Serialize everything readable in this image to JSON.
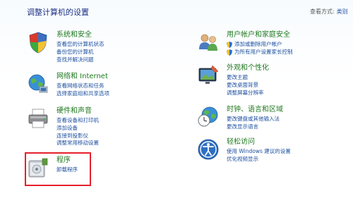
{
  "header": {
    "title": "调整计算机的设置"
  },
  "view_by": {
    "label": "查看方式:",
    "value": "类别"
  },
  "categories_left": [
    {
      "title": "系统和安全",
      "links": [
        "查看您的计算机状态",
        "备份您的计算机",
        "查找并解决问题"
      ],
      "icon": "shield-flag-icon"
    },
    {
      "title": "网络和 Internet",
      "links": [
        "查看网络状态和任务",
        "选择家庭组和共享选项"
      ],
      "icon": "network-globe-icon"
    },
    {
      "title": "硬件和声音",
      "links": [
        "查看设备和打印机",
        "添加设备",
        "连接到投影仪",
        "调整常用移动设置"
      ],
      "icon": "printer-icon"
    },
    {
      "title": "程序",
      "links": [
        "卸载程序"
      ],
      "icon": "programs-icon"
    }
  ],
  "categories_right": [
    {
      "title": "用户帐户和家庭安全",
      "links": [
        "添加或删除用户帐户",
        "为所有用户设置家长控制"
      ],
      "icon": "users-icon"
    },
    {
      "title": "外观和个性化",
      "links": [
        "更改主题",
        "更改桌面背景",
        "调整屏幕分辨率"
      ],
      "icon": "appearance-icon"
    },
    {
      "title": "时钟、语言和区域",
      "links": [
        "更改键盘或其他输入法",
        "更改显示语言"
      ],
      "icon": "clock-globe-icon"
    },
    {
      "title": "轻松访问",
      "links": [
        "使用 Windows 建议的设置",
        "优化视频显示"
      ],
      "icon": "accessibility-icon"
    }
  ]
}
